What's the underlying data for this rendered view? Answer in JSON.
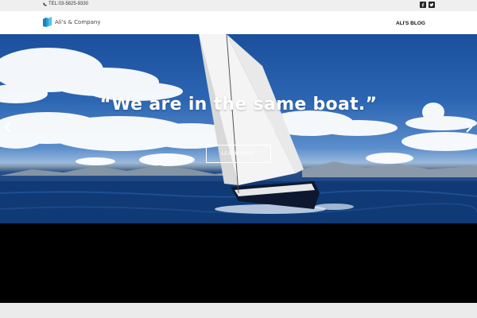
{
  "topbar": {
    "tel": "TEL:03-5825-9330",
    "icons": [
      "phone-icon",
      "facebook-icon",
      "twitter-icon"
    ]
  },
  "header": {
    "logo_text": "Ali's & Company",
    "nav_link": "ALI'S BLOG"
  },
  "hero": {
    "headline": "“We are in the same boat.”",
    "button_label": "LEARN MORE",
    "prev_icon": "chevron-left-icon",
    "next_icon": "chevron-right-icon"
  },
  "colors": {
    "header_bg": "#ffffff",
    "topbar_bg": "#efefef",
    "footer_band": "#000000",
    "logo_accent": "#2a9fd8"
  }
}
